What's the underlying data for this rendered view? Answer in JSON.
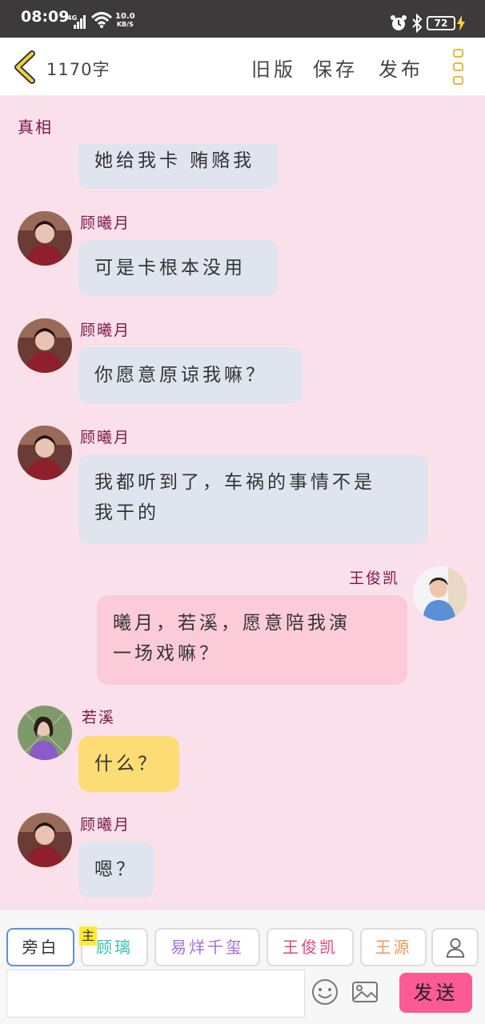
{
  "status_bar": {
    "time": "08:09",
    "network": "4G",
    "speed_value": "10.0",
    "speed_unit": "KB/S",
    "battery": "72"
  },
  "header": {
    "word_count": "1170字",
    "old_version": "旧版",
    "save": "保存",
    "publish": "发布"
  },
  "doc_title": "真相",
  "messages": [
    {
      "text_lines": [
        "她给我卡 贿赂我"
      ]
    },
    {
      "name": "顾曦月",
      "text_lines": [
        "可是卡根本没用"
      ]
    },
    {
      "name": "顾曦月",
      "text_lines": [
        "你愿意原谅我嘛？"
      ]
    },
    {
      "name": "顾曦月",
      "text_lines": [
        "我都听到了，车祸的事情不是",
        "我干的"
      ]
    },
    {
      "name": "王俊凯",
      "text_lines": [
        "曦月，若溪，愿意陪我演",
        "一场戏嘛？"
      ]
    },
    {
      "name": "若溪",
      "text_lines": [
        "什么？"
      ]
    },
    {
      "name": "顾曦月",
      "text_lines": [
        "嗯？"
      ]
    }
  ],
  "characters": {
    "narration": "旁白",
    "main_tag": "主",
    "list": [
      {
        "name": "顾璃",
        "color": "#3cc2b0"
      },
      {
        "name": "易烊千玺",
        "color": "#a86cd8"
      },
      {
        "name": "王俊凯",
        "color": "#e0487a"
      },
      {
        "name": "王源",
        "color": "#f29a55"
      }
    ]
  },
  "composer": {
    "input_value": "",
    "send": "发送"
  },
  "colors": {
    "accent_yellow": "#e7b93a",
    "name_color": "#7a1a45",
    "send_button": "#fb5a93",
    "background": "#fae0ea"
  }
}
